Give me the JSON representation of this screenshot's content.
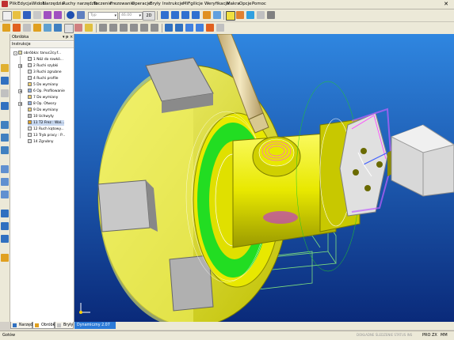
{
  "menu": {
    "items": [
      "Plik",
      "Edycja",
      "Widok",
      "Narzędzia",
      "Ruchy narzędzia",
      "Toczenie",
      "Frezowanie",
      "Operacje",
      "Bryły",
      "Instrukcje",
      "MiFgilicje",
      "Weryfikacja",
      "Makra",
      "Opcje",
      "Pomoc"
    ]
  },
  "toolbar1": {
    "combo_type": "Typ",
    "combo_size": "46.00",
    "view2d": "2D"
  },
  "panel": {
    "title": "Obróbka",
    "pin": "▾ ᵽ ×",
    "subheader": "Instrukcje",
    "root": "obróbka: tanuc2cy.f...",
    "items": [
      "1 Nóż do rowkó...",
      "2 Ruchi szybki",
      "3 Ruchi zgrubne",
      "4 Ruchi profile",
      "5 Do wymiany",
      "6 Op. Profilowanie",
      "7 Do wymiany",
      "8 Op. Otwory",
      "9 Do wymiany",
      "10 Uchwyty",
      "11 T2 Frez : Wal...",
      "12 Ruch kątowy...",
      "13 Tryb pracy : P...",
      "14 Zgrubny"
    ]
  },
  "tabs": {
    "items": [
      "Narzędzie",
      "Obróbka",
      "Bryły"
    ],
    "view": "Dynamiczny 2.07"
  },
  "status": {
    "left": "Gotów",
    "right_dim": "DOKŁADNE ŚLEDZENIE  STATUS  INS",
    "modes": [
      "PRO",
      "ZX",
      "MM"
    ]
  },
  "colors": {
    "viewport_top": "#2f86e0",
    "viewport_bottom": "#0a2a7a",
    "part_yellow": "#e8e800",
    "ring_green": "#22dd22",
    "tool_beige": "#e8d8a0",
    "menu_bg": "#ece9d8"
  }
}
